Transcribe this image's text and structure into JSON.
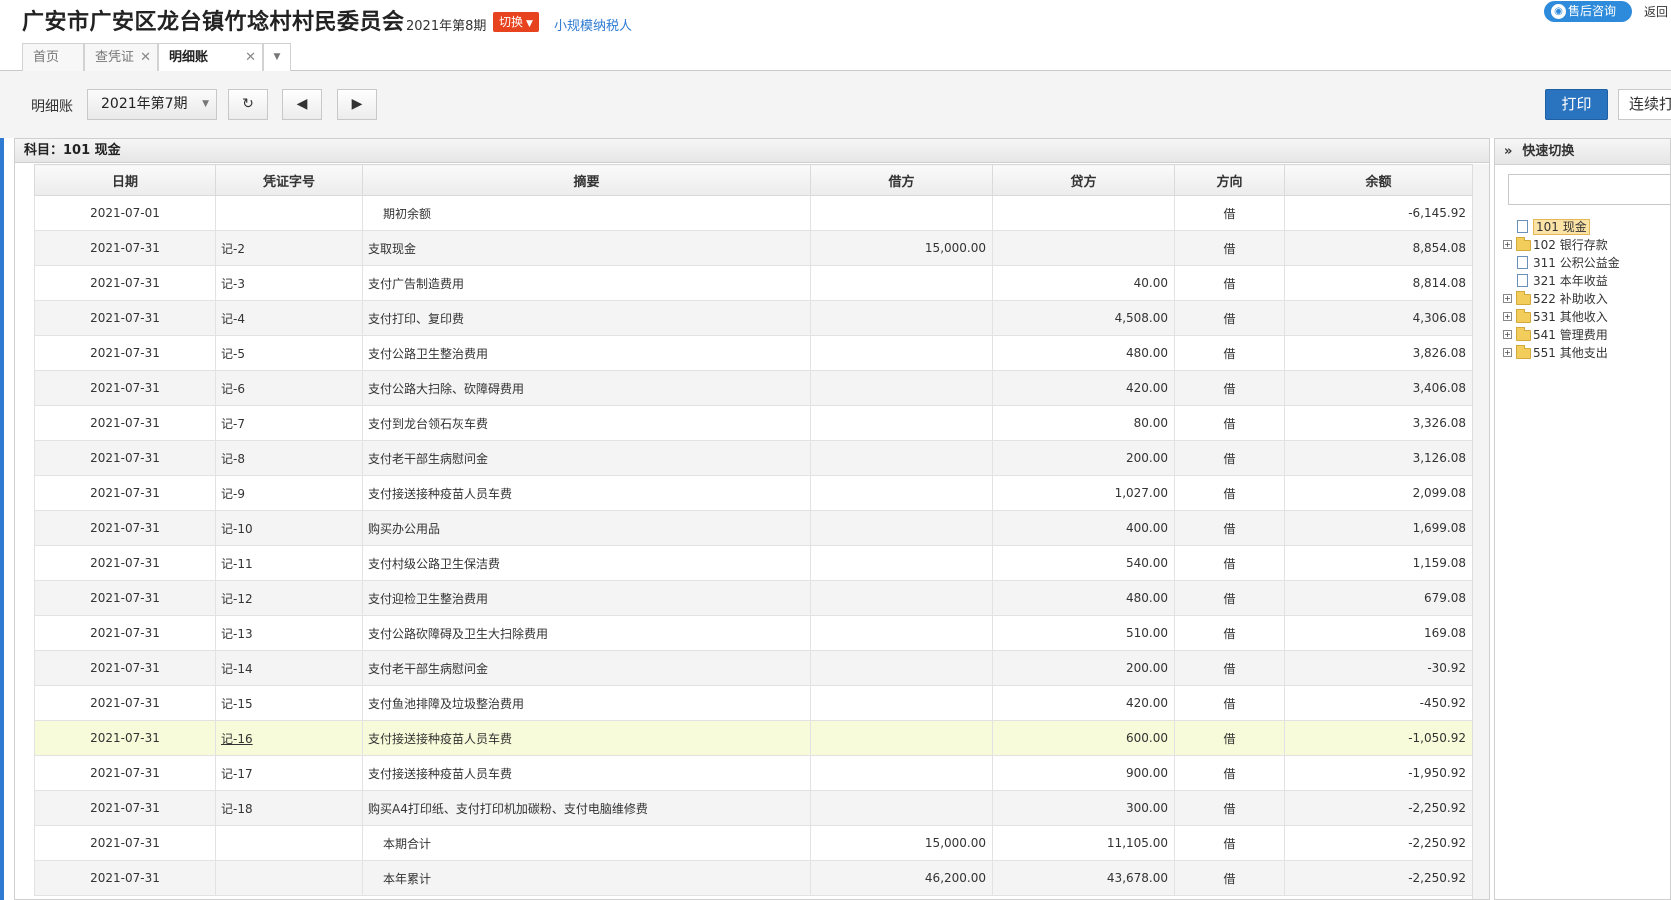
{
  "header": {
    "company": "广安市广安区龙台镇竹埝村村民委员会",
    "period": "2021年第8期",
    "switch_label": "切换",
    "taxpayer": "小规模纳税人",
    "consult_label": "售后咨询",
    "return_label": "返回"
  },
  "tabs": [
    {
      "label": "首页"
    },
    {
      "label": "查凭证"
    },
    {
      "label": "明细账"
    }
  ],
  "toolbar": {
    "label": "明细账",
    "period_select": "2021年第7期",
    "print_label": "打印",
    "continuous_print_label": "连续打印"
  },
  "ledger": {
    "subject_label": "科目：101 现金",
    "columns": {
      "date": "日期",
      "voucher": "凭证字号",
      "summary": "摘要",
      "debit": "借方",
      "credit": "贷方",
      "direction": "方向",
      "balance": "余额"
    },
    "rows": [
      {
        "date": "2021-07-01",
        "voucher": "",
        "summary": "期初余额",
        "debit": "",
        "credit": "",
        "direction": "借",
        "balance": "-6,145.92"
      },
      {
        "date": "2021-07-31",
        "voucher": "记-2",
        "summary": "支取现金",
        "debit": "15,000.00",
        "credit": "",
        "direction": "借",
        "balance": "8,854.08"
      },
      {
        "date": "2021-07-31",
        "voucher": "记-3",
        "summary": "支付广告制造费用",
        "debit": "",
        "credit": "40.00",
        "direction": "借",
        "balance": "8,814.08"
      },
      {
        "date": "2021-07-31",
        "voucher": "记-4",
        "summary": "支付打印、复印费",
        "debit": "",
        "credit": "4,508.00",
        "direction": "借",
        "balance": "4,306.08"
      },
      {
        "date": "2021-07-31",
        "voucher": "记-5",
        "summary": "支付公路卫生整治费用",
        "debit": "",
        "credit": "480.00",
        "direction": "借",
        "balance": "3,826.08"
      },
      {
        "date": "2021-07-31",
        "voucher": "记-6",
        "summary": "支付公路大扫除、砍障碍费用",
        "debit": "",
        "credit": "420.00",
        "direction": "借",
        "balance": "3,406.08"
      },
      {
        "date": "2021-07-31",
        "voucher": "记-7",
        "summary": "支付到龙台领石灰车费",
        "debit": "",
        "credit": "80.00",
        "direction": "借",
        "balance": "3,326.08"
      },
      {
        "date": "2021-07-31",
        "voucher": "记-8",
        "summary": "支付老干部生病慰问金",
        "debit": "",
        "credit": "200.00",
        "direction": "借",
        "balance": "3,126.08"
      },
      {
        "date": "2021-07-31",
        "voucher": "记-9",
        "summary": "支付接送接种疫苗人员车费",
        "debit": "",
        "credit": "1,027.00",
        "direction": "借",
        "balance": "2,099.08"
      },
      {
        "date": "2021-07-31",
        "voucher": "记-10",
        "summary": "购买办公用品",
        "debit": "",
        "credit": "400.00",
        "direction": "借",
        "balance": "1,699.08"
      },
      {
        "date": "2021-07-31",
        "voucher": "记-11",
        "summary": "支付村级公路卫生保洁费",
        "debit": "",
        "credit": "540.00",
        "direction": "借",
        "balance": "1,159.08"
      },
      {
        "date": "2021-07-31",
        "voucher": "记-12",
        "summary": "支付迎检卫生整治费用",
        "debit": "",
        "credit": "480.00",
        "direction": "借",
        "balance": "679.08"
      },
      {
        "date": "2021-07-31",
        "voucher": "记-13",
        "summary": "支付公路砍障碍及卫生大扫除费用",
        "debit": "",
        "credit": "510.00",
        "direction": "借",
        "balance": "169.08"
      },
      {
        "date": "2021-07-31",
        "voucher": "记-14",
        "summary": "支付老干部生病慰问金",
        "debit": "",
        "credit": "200.00",
        "direction": "借",
        "balance": "-30.92"
      },
      {
        "date": "2021-07-31",
        "voucher": "记-15",
        "summary": "支付鱼池排障及垃圾整治费用",
        "debit": "",
        "credit": "420.00",
        "direction": "借",
        "balance": "-450.92"
      },
      {
        "date": "2021-07-31",
        "voucher": "记-16",
        "summary": "支付接送接种疫苗人员车费",
        "debit": "",
        "credit": "600.00",
        "direction": "借",
        "balance": "-1,050.92"
      },
      {
        "date": "2021-07-31",
        "voucher": "记-17",
        "summary": "支付接送接种疫苗人员车费",
        "debit": "",
        "credit": "900.00",
        "direction": "借",
        "balance": "-1,950.92"
      },
      {
        "date": "2021-07-31",
        "voucher": "记-18",
        "summary": "购买A4打印纸、支付打印机加碳粉、支付电脑维修费",
        "debit": "",
        "credit": "300.00",
        "direction": "借",
        "balance": "-2,250.92"
      },
      {
        "date": "2021-07-31",
        "voucher": "",
        "summary": "本期合计",
        "debit": "15,000.00",
        "credit": "11,105.00",
        "direction": "借",
        "balance": "-2,250.92"
      },
      {
        "date": "2021-07-31",
        "voucher": "",
        "summary": "本年累计",
        "debit": "46,200.00",
        "credit": "43,678.00",
        "direction": "借",
        "balance": "-2,250.92"
      }
    ]
  },
  "quick_switch": {
    "title": "快速切换",
    "search_value": "",
    "tree": [
      {
        "label": "101 现金",
        "type": "doc",
        "expandable": false,
        "selected": true
      },
      {
        "label": "102 银行存款",
        "type": "folder",
        "expandable": true,
        "selected": false
      },
      {
        "label": "311 公积公益金",
        "type": "doc",
        "expandable": false,
        "selected": false
      },
      {
        "label": "321 本年收益",
        "type": "doc",
        "expandable": false,
        "selected": false
      },
      {
        "label": "522 补助收入",
        "type": "folder",
        "expandable": true,
        "selected": false
      },
      {
        "label": "531 其他收入",
        "type": "folder",
        "expandable": true,
        "selected": false
      },
      {
        "label": "541 管理费用",
        "type": "folder",
        "expandable": true,
        "selected": false
      },
      {
        "label": "551 其他支出",
        "type": "folder",
        "expandable": true,
        "selected": false
      }
    ]
  },
  "colors": {
    "accent": "#2f7bd2",
    "switch_button": "#e8431f",
    "print_button": "#2a73bf",
    "highlight_row": "#f7fbd9"
  }
}
